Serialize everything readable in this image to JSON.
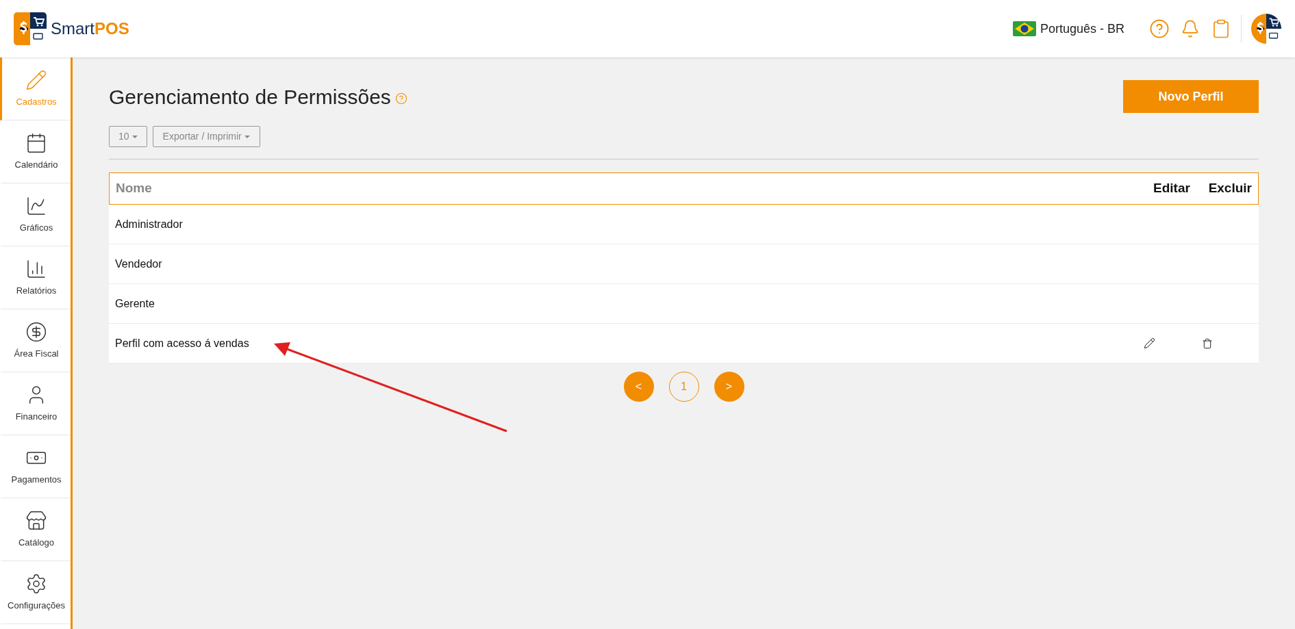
{
  "header": {
    "logo": {
      "word1": "Smart",
      "word2": "POS"
    },
    "language": "Português - BR"
  },
  "sidebar": {
    "items": [
      {
        "label": "Cadastros",
        "selected": true
      },
      {
        "label": "Calendário",
        "selected": false
      },
      {
        "label": "Gráficos",
        "selected": false
      },
      {
        "label": "Relatórios",
        "selected": false
      },
      {
        "label": "Área Fiscal",
        "selected": false
      },
      {
        "label": "Financeiro",
        "selected": false
      },
      {
        "label": "Pagamentos",
        "selected": false
      },
      {
        "label": "Catálogo",
        "selected": false
      },
      {
        "label": "Configurações",
        "selected": false
      }
    ]
  },
  "page": {
    "title": "Gerenciamento de Permissões",
    "new_button": "Novo Perfil",
    "page_size": "10",
    "export_button": "Exportar / Imprimir"
  },
  "table": {
    "columns": [
      "Nome",
      "Editar",
      "Excluir"
    ],
    "rows": [
      {
        "name": "Administrador",
        "actions_visible": false
      },
      {
        "name": "Vendedor",
        "actions_visible": false
      },
      {
        "name": "Gerente",
        "actions_visible": false
      },
      {
        "name": "Perfil com acesso á vendas",
        "actions_visible": true
      }
    ]
  },
  "pagination": {
    "prev": "<",
    "page": "1",
    "next": ">"
  }
}
